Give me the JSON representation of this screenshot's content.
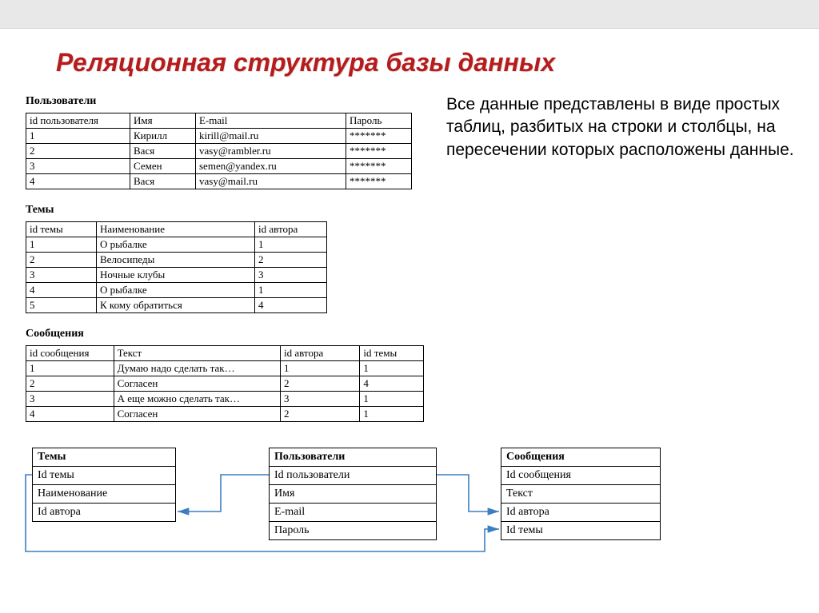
{
  "title": "Реляционная структура базы данных",
  "description": "Все данные представлены в виде простых таблиц, разбитых на строки и столбцы, на пересечении которых расположены данные.",
  "tables": {
    "users": {
      "caption": "Пользователи",
      "headers": [
        "id пользователя",
        "Имя",
        "E-mail",
        "Пароль"
      ],
      "rows": [
        [
          "1",
          "Кирилл",
          "kirill@mail.ru",
          "*******"
        ],
        [
          "2",
          "Вася",
          "vasy@rambler.ru",
          "*******"
        ],
        [
          "3",
          "Семен",
          "semen@yandex.ru",
          "*******"
        ],
        [
          "4",
          "Вася",
          "vasy@mail.ru",
          "*******"
        ]
      ]
    },
    "topics": {
      "caption": "Темы",
      "headers": [
        "id темы",
        "Наименование",
        "id автора"
      ],
      "rows": [
        [
          "1",
          "О рыбалке",
          "1"
        ],
        [
          "2",
          "Велосипеды",
          "2"
        ],
        [
          "3",
          "Ночные клубы",
          "3"
        ],
        [
          "4",
          "О рыбалке",
          "1"
        ],
        [
          "5",
          "К кому обратиться",
          "4"
        ]
      ]
    },
    "messages": {
      "caption": "Сообщения",
      "headers": [
        "id сообщения",
        "Текст",
        "id автора",
        "id темы"
      ],
      "rows": [
        [
          "1",
          "Думаю надо сделать так…",
          "1",
          "1"
        ],
        [
          "2",
          "Согласен",
          "2",
          "4"
        ],
        [
          "3",
          "А еще можно сделать так…",
          "3",
          "1"
        ],
        [
          "4",
          "Согласен",
          "2",
          "1"
        ]
      ]
    }
  },
  "schema": {
    "topics": {
      "title": "Темы",
      "fields": [
        "Id темы",
        "Наименование",
        "Id автора"
      ]
    },
    "users": {
      "title": "Пользователи",
      "fields": [
        "Id пользователи",
        "Имя",
        "E-mail",
        "Пароль"
      ]
    },
    "messages": {
      "title": "Сообщения",
      "fields": [
        "Id сообщения",
        "Текст",
        "Id автора",
        "Id темы"
      ]
    }
  }
}
